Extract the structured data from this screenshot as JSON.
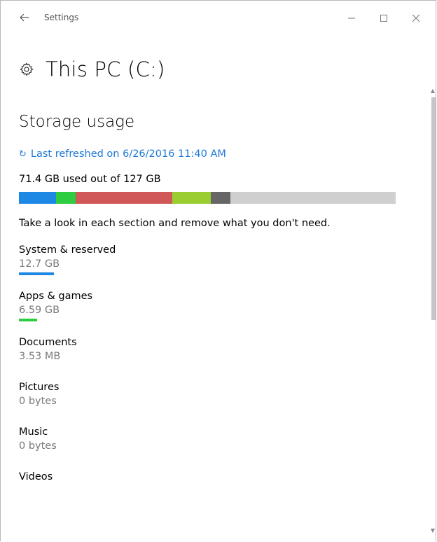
{
  "titlebar": {
    "app_title": "Settings"
  },
  "page": {
    "title": "This PC (C:)"
  },
  "storage": {
    "section_title": "Storage usage",
    "refresh_text": "Last refreshed on 6/26/2016 11:40 AM",
    "used_text": "71.4 GB used out of 127 GB",
    "bar_segments": [
      {
        "name": "segment-system",
        "fraction": 0.0985,
        "color": "#1e88e5"
      },
      {
        "name": "segment-apps",
        "fraction": 0.052,
        "color": "#2ecc40"
      },
      {
        "name": "segment-red",
        "fraction": 0.2565,
        "color": "#d05858"
      },
      {
        "name": "segment-lime",
        "fraction": 0.1022,
        "color": "#9acd32"
      },
      {
        "name": "segment-gray",
        "fraction": 0.052,
        "color": "#666666"
      }
    ],
    "bar_background": "#cfcfcf",
    "hint": "Take a look in each section and remove what you don't need."
  },
  "categories": [
    {
      "name": "System & reserved",
      "size": "12.7 GB",
      "bar_fraction": 0.5,
      "color": "#1e88e5"
    },
    {
      "name": "Apps & games",
      "size": "6.59 GB",
      "bar_fraction": 0.26,
      "color": "#2ecc40"
    },
    {
      "name": "Documents",
      "size": "3.53 MB",
      "bar_fraction": 0,
      "color": ""
    },
    {
      "name": "Pictures",
      "size": "0 bytes",
      "bar_fraction": 0,
      "color": ""
    },
    {
      "name": "Music",
      "size": "0 bytes",
      "bar_fraction": 0,
      "color": ""
    },
    {
      "name": "Videos",
      "size": "",
      "bar_fraction": 0,
      "color": ""
    }
  ],
  "icons": {
    "back": "back-arrow-icon",
    "minimize": "minimize-icon",
    "maximize": "maximize-icon",
    "close": "close-icon",
    "gear": "gear-icon",
    "refresh": "refresh-icon"
  }
}
